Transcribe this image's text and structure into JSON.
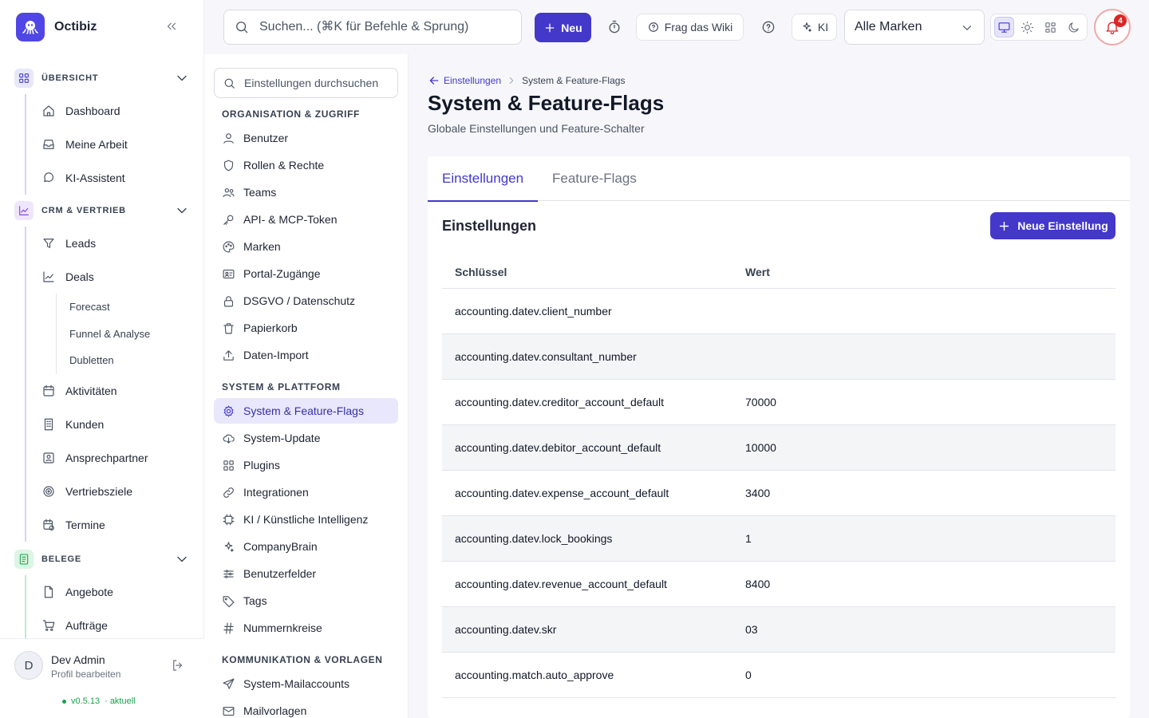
{
  "app": {
    "name": "Octibiz"
  },
  "topbar": {
    "search_placeholder": "Suchen... (⌘K für Befehle & Sprung)",
    "new_label": "Neu",
    "wiki_label": "Frag das Wiki",
    "ai_label": "KI",
    "brand_select": "Alle Marken",
    "notifications_count": "4"
  },
  "sidebar": {
    "groups": [
      {
        "label": "ÜBERSICHT",
        "items": [
          "Dashboard",
          "Meine Arbeit",
          "KI-Assistent"
        ]
      },
      {
        "label": "CRM & VERTRIEB",
        "items": [
          "Leads",
          "Deals"
        ],
        "sub": [
          "Forecast",
          "Funnel & Analyse",
          "Dubletten"
        ],
        "items_after": [
          "Aktivitäten",
          "Kunden",
          "Ansprechpartner",
          "Vertriebsziele",
          "Termine"
        ]
      },
      {
        "label": "BELEGE",
        "items": [
          "Angebote",
          "Aufträge"
        ]
      }
    ],
    "user": {
      "name": "Dev Admin",
      "sub": "Profil bearbeiten",
      "initial": "D",
      "version": "v0.5.13",
      "version_status": "· aktuell"
    }
  },
  "settings_nav": {
    "search_placeholder": "Einstellungen durchsuchen",
    "sections": [
      {
        "label": "ORGANISATION & ZUGRIFF",
        "items": [
          "Benutzer",
          "Rollen & Rechte",
          "Teams",
          "API- & MCP-Token",
          "Marken",
          "Portal-Zugänge",
          "DSGVO / Datenschutz",
          "Papierkorb",
          "Daten-Import"
        ]
      },
      {
        "label": "SYSTEM & PLATTFORM",
        "items": [
          "System & Feature-Flags",
          "System-Update",
          "Plugins",
          "Integrationen",
          "KI / Künstliche Intelligenz",
          "CompanyBrain",
          "Benutzerfelder",
          "Tags",
          "Nummernkreise"
        ]
      },
      {
        "label": "KOMMUNIKATION & VORLAGEN",
        "items": [
          "System-Mailaccounts",
          "Mailvorlagen"
        ]
      }
    ]
  },
  "main": {
    "breadcrumb": {
      "back": "Einstellungen",
      "current": "System & Feature-Flags"
    },
    "title": "System & Feature-Flags",
    "subtitle": "Globale Einstellungen und Feature-Schalter",
    "tabs": [
      "Einstellungen",
      "Feature-Flags"
    ],
    "card_title": "Einstellungen",
    "add_button": "Neue Einstellung",
    "columns": [
      "Schlüssel",
      "Wert"
    ],
    "rows": [
      {
        "key": "accounting.datev.client_number",
        "value": ""
      },
      {
        "key": "accounting.datev.consultant_number",
        "value": ""
      },
      {
        "key": "accounting.datev.creditor_account_default",
        "value": "70000"
      },
      {
        "key": "accounting.datev.debitor_account_default",
        "value": "10000"
      },
      {
        "key": "accounting.datev.expense_account_default",
        "value": "3400"
      },
      {
        "key": "accounting.datev.lock_bookings",
        "value": "1"
      },
      {
        "key": "accounting.datev.revenue_account_default",
        "value": "8400"
      },
      {
        "key": "accounting.datev.skr",
        "value": "03"
      },
      {
        "key": "accounting.match.auto_approve",
        "value": "0"
      }
    ]
  },
  "colors": {
    "accent": "#4338ca",
    "danger": "#dc2626",
    "success": "#16a34a"
  }
}
